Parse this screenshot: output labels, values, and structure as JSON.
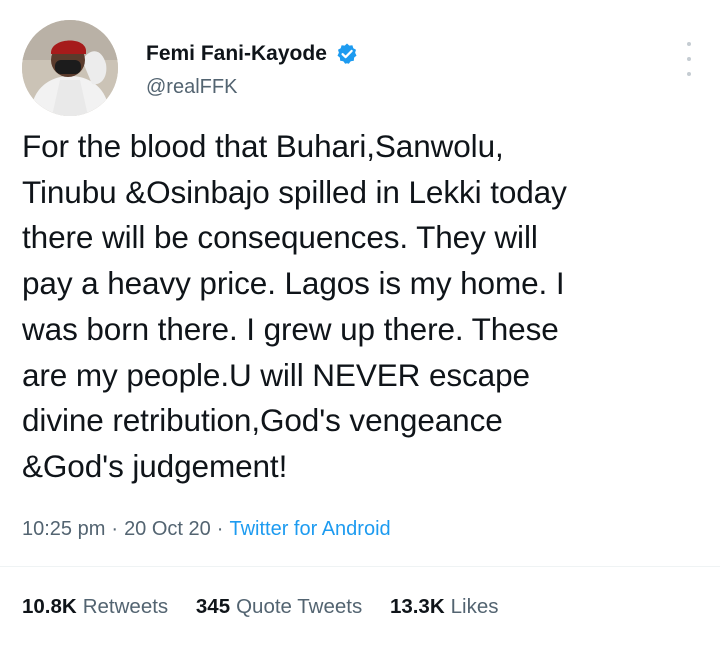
{
  "author": {
    "display_name": "Femi Fani-Kayode",
    "handle": "@realFFK",
    "verified": true,
    "avatar_icon": "profile-photo",
    "accent_color": "#1d9bf0"
  },
  "tweet": {
    "text": "For the blood that Buhari,Sanwolu,\nTinubu &Osinbajo spilled in Lekki today\nthere will be consequences. They will\npay a heavy price. Lagos is my home. I\nwas born there. I grew up there. These\nare my people.U will NEVER escape\ndivine retribution,God's vengeance\n&God's judgement!",
    "time": "10:25 pm",
    "separator": "·",
    "date": "20 Oct 20",
    "source": "Twitter for Android"
  },
  "stats": {
    "retweets_count": "10.8K",
    "retweets_label": "Retweets",
    "quotes_count": "345",
    "quotes_label": "Quote Tweets",
    "likes_count": "13.3K",
    "likes_label": "Likes"
  },
  "icons": {
    "verified": "verified-badge-icon",
    "more": "more-options-icon"
  }
}
